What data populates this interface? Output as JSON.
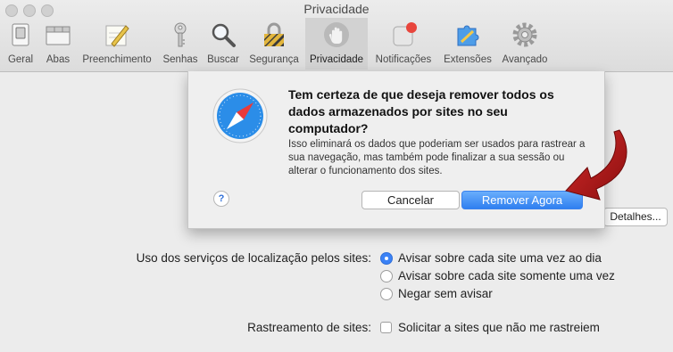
{
  "window": {
    "title": "Privacidade"
  },
  "toolbar": {
    "items": [
      {
        "label": "Geral",
        "icon": "switch-icon"
      },
      {
        "label": "Abas",
        "icon": "tabs-icon"
      },
      {
        "label": "Preenchimento",
        "icon": "pencil-icon"
      },
      {
        "label": "Senhas",
        "icon": "key-icon"
      },
      {
        "label": "Buscar",
        "icon": "magnifier-icon"
      },
      {
        "label": "Segurança",
        "icon": "lock-icon"
      },
      {
        "label": "Privacidade",
        "icon": "hand-icon",
        "selected": true
      },
      {
        "label": "Notificações",
        "icon": "notification-icon"
      },
      {
        "label": "Extensões",
        "icon": "puzzle-icon"
      },
      {
        "label": "Avançado",
        "icon": "gear-icon"
      }
    ]
  },
  "dialog": {
    "title": "Tem certeza de que deseja remover todos os dados armazenados por sites no seu computador?",
    "body": "Isso eliminará os dados que poderiam ser usados para rastrear a sua navegação, mas também pode finalizar a sua sessão ou alterar o funcionamento dos sites.",
    "help": "?",
    "cancel_label": "Cancelar",
    "confirm_label": "Remover Agora"
  },
  "details_label": "Detalhes...",
  "location": {
    "label": "Uso dos serviços de localização pelos sites:",
    "options": [
      {
        "label": "Avisar sobre cada site uma vez ao dia",
        "selected": true
      },
      {
        "label": "Avisar sobre cada site somente uma vez",
        "selected": false
      },
      {
        "label": "Negar sem avisar",
        "selected": false
      }
    ]
  },
  "tracking": {
    "label": "Rastreamento de sites:",
    "option": "Solicitar a sites que não me rastreiem",
    "checked": false
  },
  "colors": {
    "accent": "#2f7ff0",
    "arrow": "#b01818"
  }
}
